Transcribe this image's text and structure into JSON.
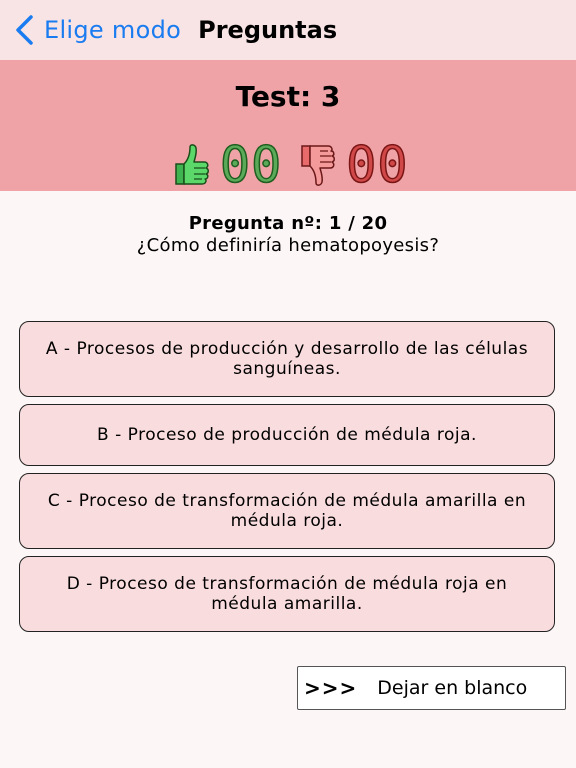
{
  "nav": {
    "back_label": "Elige modo",
    "title": "Preguntas"
  },
  "score": {
    "test_title": "Test: 3",
    "correct_count": "00",
    "wrong_count": "00",
    "correct_icon": "thumbs-up-icon",
    "wrong_icon": "thumbs-down-icon",
    "correct_color": "#3fb34f",
    "wrong_color": "#e86a6a"
  },
  "question": {
    "number": "Pregunta nº: 1 / 20",
    "text": "¿Cómo definiría hematopoyesis?"
  },
  "options": [
    {
      "text": "A - Procesos de producción y desarrollo de las células sanguíneas."
    },
    {
      "text": "B - Proceso de producción de médula roja."
    },
    {
      "text": "C - Proceso de transformación de médula amarilla en médula roja."
    },
    {
      "text": "D - Proceso de transformación de médula roja en médula amarilla."
    }
  ],
  "skip": {
    "arrows": ">>>",
    "label": "Dejar en blanco"
  },
  "colors": {
    "accent": "#1a7cf0",
    "nav_bg": "#f8e4e4",
    "panel_bg": "#f0a3a6",
    "option_bg": "#f9dcdd"
  }
}
